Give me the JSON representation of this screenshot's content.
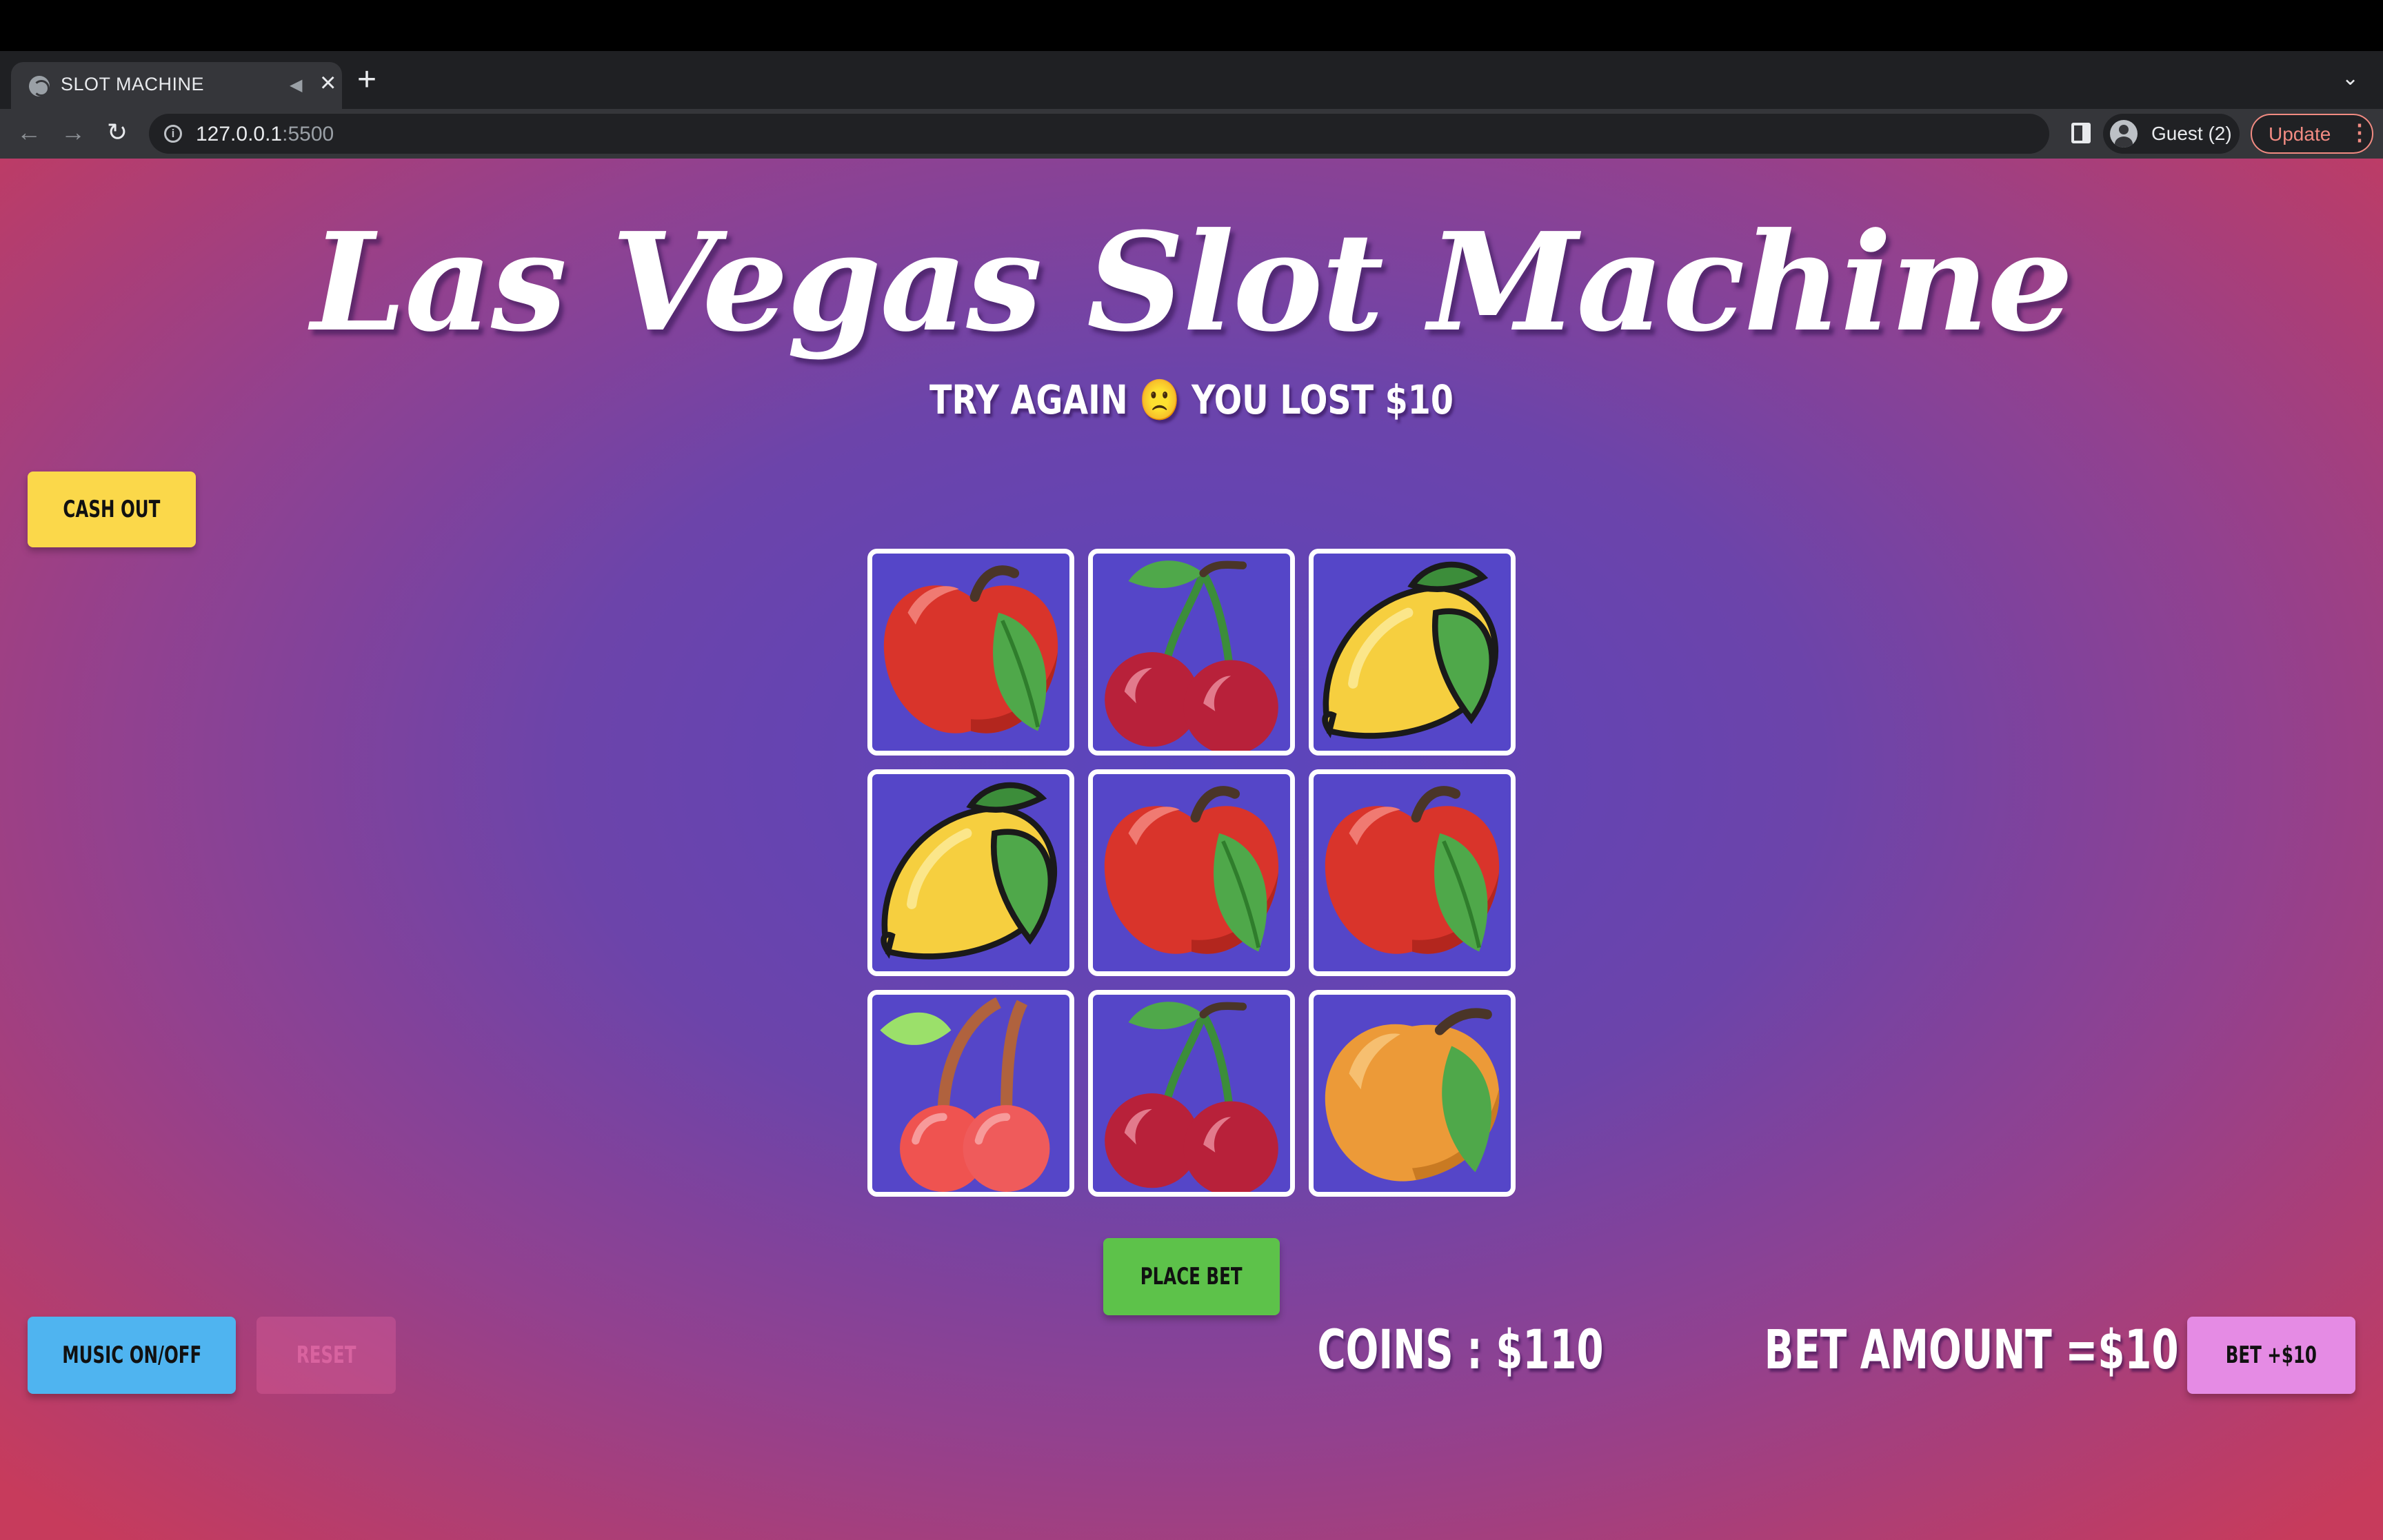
{
  "browser": {
    "tab_title": "SLOT MACHINE",
    "new_tab_symbol": "+",
    "url_host": "127.0.0.1",
    "url_port": ":5500",
    "profile_label": "Guest (2)",
    "update_label": "Update"
  },
  "game": {
    "title": "Las Vegas Slot Machine",
    "status": "TRY AGAIN 🙁 YOU LOST $10",
    "cash_out_label": "CASH OUT",
    "place_bet_label": "PLACE BET",
    "music_label": "MUSIC ON/OFF",
    "reset_label": "RESET",
    "bet_plus_label": "BET +$10",
    "coins_text": "COINS : $110",
    "bet_amount_text": "BET AMOUNT =$10"
  },
  "reels": [
    [
      "apple-icon",
      "cherries-icon",
      "lemon-icon"
    ],
    [
      "lemon-icon",
      "apple-icon",
      "apple-icon"
    ],
    [
      "cherry-icon",
      "cherries-icon",
      "orange-icon"
    ]
  ],
  "colors": {
    "cash_out": "#fbd84a",
    "place_bet": "#5dc24a",
    "music": "#4fb4f0",
    "bet_plus": "#e58be4",
    "reel_bg": "#5546c8"
  }
}
